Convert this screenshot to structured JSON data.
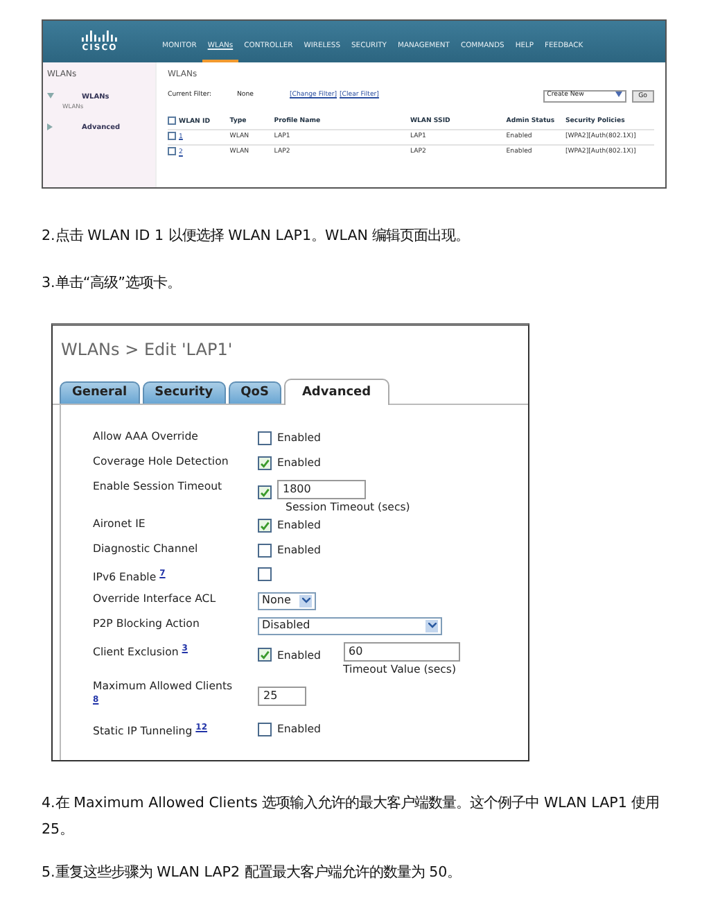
{
  "figure_1": {
    "logo": "CISCO",
    "menu": [
      {
        "label": "MONITOR",
        "selected": false
      },
      {
        "label": "WLANs",
        "selected": true
      },
      {
        "label": "CONTROLLER",
        "selected": false
      },
      {
        "label": "WIRELESS",
        "selected": false
      },
      {
        "label": "SECURITY",
        "selected": false
      },
      {
        "label": "MANAGEMENT",
        "selected": false
      },
      {
        "label": "COMMANDS",
        "selected": false
      },
      {
        "label": "HELP",
        "selected": false
      },
      {
        "label": "FEEDBACK",
        "selected": false
      }
    ],
    "sidebar": {
      "title": "WLANs",
      "items": [
        {
          "label": "WLANs",
          "sub": "WLANs",
          "expanded": true
        },
        {
          "label": "Advanced",
          "expanded": false
        }
      ]
    },
    "page_title": "WLANs",
    "filter_label": "Current Filter:",
    "filter_value": "None",
    "filter_links": [
      "[Change Filter]",
      "[Clear Filter]"
    ],
    "action_select": "Create New",
    "go_button": "Go",
    "table": {
      "all_checked": false,
      "columns": [
        "WLAN ID",
        "Type",
        "Profile Name",
        "WLAN SSID",
        "Admin Status",
        "Security Policies"
      ],
      "rows": [
        {
          "checked": false,
          "cells": [
            "1",
            "WLAN",
            "LAP1",
            "LAP1",
            "Enabled",
            "[WPA2][Auth(802.1X)]"
          ]
        },
        {
          "checked": false,
          "cells": [
            "2",
            "WLAN",
            "LAP2",
            "LAP2",
            "Enabled",
            "[WPA2][Auth(802.1X)]"
          ]
        }
      ]
    }
  },
  "step_2": "2.点击 WLAN ID 1 以便选择 WLAN LAP1。WLAN 编辑页面出现。",
  "step_3": "3.单击“高级”选项卡。",
  "figure_2": {
    "breadcrumb": "WLANs > Edit  'LAP1'",
    "tabs": [
      {
        "label": "General",
        "selected": false
      },
      {
        "label": "Security",
        "selected": false
      },
      {
        "label": "QoS",
        "selected": false
      },
      {
        "label": "Advanced",
        "selected": true
      }
    ],
    "fields": [
      {
        "kind": "checkbox",
        "label": "Allow AAA Override",
        "checked": false,
        "option": "Enabled"
      },
      {
        "kind": "checkbox",
        "label": "Coverage Hole Detection",
        "checked": true,
        "option": "Enabled"
      },
      {
        "kind": "timeout",
        "label": "Enable Session Timeout",
        "checked": true,
        "value": "1800",
        "caption": "Session Timeout (secs)"
      },
      {
        "kind": "checkbox",
        "label": "Aironet IE",
        "checked": true,
        "option": "Enabled"
      },
      {
        "kind": "checkbox",
        "label": "Diagnostic Channel",
        "checked": false,
        "option": "Enabled"
      },
      {
        "kind": "checkbox",
        "label": "IPv6 Enable",
        "note": "7",
        "checked": false
      },
      {
        "kind": "select",
        "label": "Override Interface ACL",
        "value": "None",
        "wide": false
      },
      {
        "kind": "select",
        "label": "P2P Blocking Action",
        "value": "Disabled",
        "wide": true
      },
      {
        "kind": "timeout",
        "label": "Client Exclusion",
        "note": "3",
        "checked": true,
        "option": "Enabled",
        "value": "60",
        "caption": "Timeout Value (secs)"
      },
      {
        "kind": "text",
        "label": "Maximum Allowed Clients",
        "note": "8",
        "value": "25"
      },
      {
        "kind": "checkbox",
        "label": "Static IP Tunneling",
        "note": "12",
        "checked": false,
        "option": "Enabled"
      }
    ]
  },
  "step_4": "4.在 Maximum Allowed Clients 选项输入允许的最大客户端数量。这个例子中 WLAN LAP1 使用 25。",
  "step_5": "5.重复这些步骤为 WLAN LAP2 配置最大客户端允许的数量为 50。"
}
